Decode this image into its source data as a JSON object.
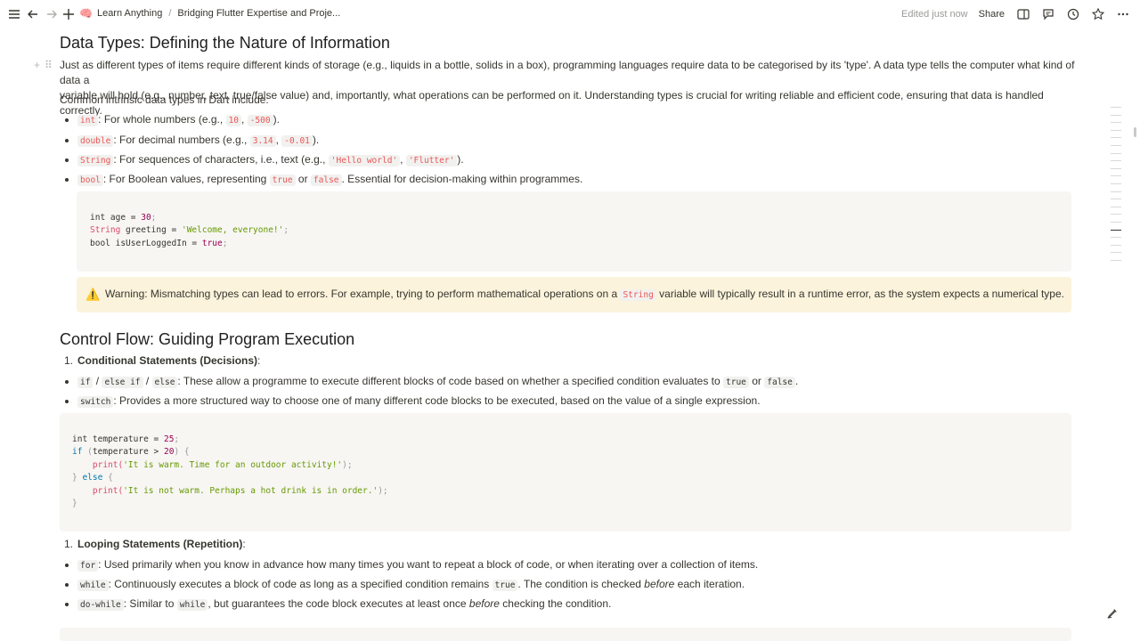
{
  "breadcrumb": {
    "workspace_icon": "🧠",
    "workspace": "Learn Anything",
    "separator": "/",
    "page": "Bridging Flutter Expertise and Proje..."
  },
  "header": {
    "edited": "Edited just now",
    "share": "Share"
  },
  "section1": {
    "title": "Data Types: Defining the Nature of Information",
    "intro_line1": "Just as different types of items require different kinds of storage (e.g., liquids in a bottle, solids in a box), programming languages require data to be categorised by its 'type'. A data type tells the computer what kind of data a",
    "intro_line2": "variable will hold (e.g., number, text, true/false value) and, importantly, what operations can be performed on it. Understanding types is crucial for writing reliable and efficient code, ensuring that data is handled correctly.",
    "lead": "Common intrinsic data types in Dart include:",
    "items": [
      {
        "code": "int",
        "text": ": For whole numbers (e.g., ",
        "ex1": "10",
        "mid": ", ",
        "ex2": "-500",
        "end": ")."
      },
      {
        "code": "double",
        "text": ": For decimal numbers (e.g., ",
        "ex1": "3.14",
        "mid": ", ",
        "ex2": "-0.01",
        "end": ")."
      },
      {
        "code": "String",
        "text": ": For sequences of characters, i.e., text (e.g., ",
        "ex1": "'Hello world'",
        "mid": ", ",
        "ex2": "'Flutter'",
        "end": ")."
      },
      {
        "code": "bool",
        "text": ": For Boolean values, representing ",
        "ex1": "true",
        "mid": " or ",
        "ex2": "false",
        "end": ". Essential for decision-making within programmes."
      }
    ],
    "code1": {
      "l1_type": "int",
      "l1_rest": " age = ",
      "l1_num": "30",
      "l1_end": ";",
      "l2_type": "String",
      "l2_rest": " greeting = ",
      "l2_str": "'Welcome, everyone!'",
      "l2_end": ";",
      "l3_type": "bool",
      "l3_rest": " isUserLoggedIn = ",
      "l3_val": "true",
      "l3_end": ";"
    },
    "warning": {
      "icon": "⚠️",
      "pre": "Warning: Mismatching types can lead to errors. For example, trying to perform mathematical operations on a ",
      "code": "String",
      "post": " variable will typically result in a runtime error, as the system expects a numerical type."
    }
  },
  "section2": {
    "title": "Control Flow: Guiding Program Execution",
    "cond": {
      "num": "1.",
      "title": "Conditional Statements (Decisions)",
      "colon": ":"
    },
    "cond_items": [
      {
        "c1": "if",
        "s1": " / ",
        "c2": "else if",
        "s2": " / ",
        "c3": "else",
        "text": ": These allow a programme to execute different blocks of code based on whether a specified condition evaluates to ",
        "c4": "true",
        "mid": " or ",
        "c5": "false",
        "end": "."
      },
      {
        "c1": "switch",
        "text": ": Provides a more structured way to choose one of many different code blocks to be executed, based on the value of a single expression."
      }
    ],
    "code2": {
      "l1a": "int",
      "l1b": " temperature = ",
      "l1c": "25",
      "l1d": ";",
      "l2a": "if",
      "l2b": " (",
      "l2c": "temperature > ",
      "l2d": "20",
      "l2e": ") {",
      "l3a": "    print(",
      "l3b": "'It is warm. Time for an outdoor activity!'",
      "l3c": ");",
      "l4a": "} ",
      "l4b": "else",
      "l4c": " {",
      "l5a": "    print(",
      "l5b": "'It is not warm. Perhaps a hot drink is in order.'",
      "l5c": ");",
      "l6": "}"
    },
    "loop": {
      "num": "1.",
      "title": "Looping Statements (Repetition)",
      "colon": ":"
    },
    "loop_items": [
      {
        "code": "for",
        "text": ": Used primarily when you know in advance how many times you want to repeat a block of code, or when iterating over a collection of items."
      },
      {
        "code": "while",
        "text": ": Continuously executes a block of code as long as a specified condition remains ",
        "code2": "true",
        "text2": ". The condition is checked ",
        "em": "before",
        "text3": " each iteration."
      },
      {
        "code": "do-while",
        "text": ": Similar to ",
        "code2": "while",
        "text2": ", but guarantees the code block executes at least once ",
        "em": "before",
        "text3": " checking the condition."
      }
    ]
  }
}
